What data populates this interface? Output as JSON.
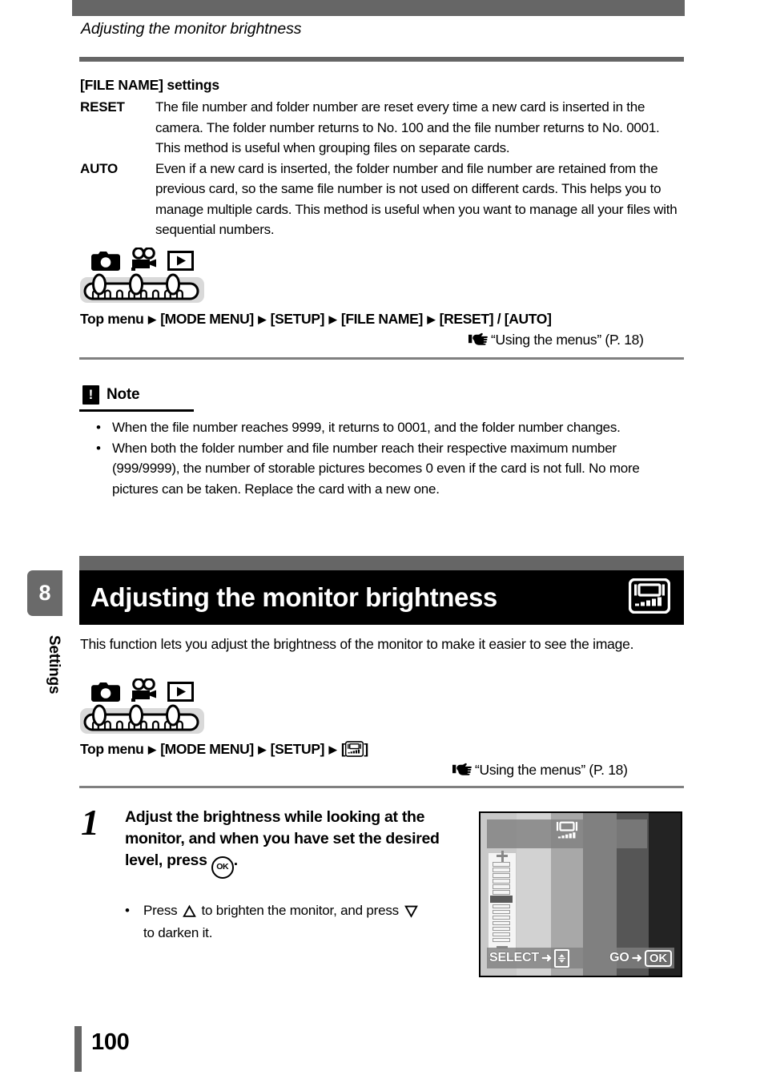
{
  "page": {
    "running_head": "Adjusting the monitor brightness",
    "number": "100"
  },
  "chapter_tab": {
    "number": "8",
    "label": "Settings"
  },
  "file_name_section": {
    "title": "[FILE NAME] settings",
    "definitions": [
      {
        "term": "RESET",
        "body": "The file number and folder number are reset every time a new card is inserted in the camera. The folder number returns to No. 100 and the file number returns to No. 0001. This method is useful when grouping files on separate cards."
      },
      {
        "term": "AUTO",
        "body": "Even if a new card is inserted, the folder number and file number are retained from the previous card, so the same file number is not used on different cards. This helps you to manage multiple cards. This method is useful when you want to manage all your files with sequential numbers."
      }
    ],
    "mode_icons": [
      "camera-icon",
      "movie-icon",
      "playback-icon",
      "mode-dial-icon"
    ],
    "path": {
      "start": "Top menu",
      "arrow": "▶",
      "steps": [
        "[MODE MENU]",
        "[SETUP]",
        "[FILE NAME]",
        "[RESET] / [AUTO]"
      ]
    },
    "reference": {
      "hand": "hand-pointer-icon",
      "text": "“Using the menus” (P. 18)"
    }
  },
  "note": {
    "badge": "!",
    "label": "Note",
    "bullet": "•",
    "items": [
      "When the file number reaches 9999, it returns to 0001, and the folder number changes.",
      "When both the folder number and file number reach their respective maximum number (999/9999), the number of storable pictures becomes 0 even if the card is not full. No more pictures can be taken. Replace the card with a new one."
    ]
  },
  "brightness_section": {
    "banner_title": "Adjusting the monitor brightness",
    "banner_icon": "monitor-brightness-icon",
    "intro": "This function lets you adjust the brightness of the monitor to make it easier to see the image.",
    "mode_icons": [
      "camera-icon",
      "movie-icon",
      "playback-icon",
      "mode-dial-icon"
    ],
    "path": {
      "start": "Top menu",
      "arrow": "▶",
      "steps": [
        "[MODE MENU]",
        "[SETUP]"
      ],
      "final_open": "[",
      "final_icon": "monitor-brightness-icon",
      "final_close": "]"
    },
    "reference": {
      "hand": "hand-pointer-icon",
      "text": "“Using the menus” (P. 18)"
    }
  },
  "step": {
    "number": "1",
    "instruction_a": "Adjust the brightness while looking at the monitor, and when you have set the desired level, press ",
    "ok_glyph": "OK",
    "instruction_b": ".",
    "bullet": "•",
    "sub_a": "Press ",
    "up_glyph": "up-triangle-icon",
    "sub_b": " to brighten the monitor, and press ",
    "down_glyph": "down-triangle-icon",
    "sub_c": " to darken it."
  },
  "camera_screen": {
    "top_icon": "monitor-brightness-icon",
    "slider": {
      "plus": "+",
      "minus": "−",
      "segments": 14,
      "active_index": 6
    },
    "osd_left_label": "SELECT",
    "osd_left_arrow": "➜",
    "osd_left_icon": "up-down-pad-icon",
    "osd_right_label": "GO",
    "osd_right_arrow": "➜",
    "osd_right_button": "OK",
    "gradient_bands": [
      "#c9c9c9",
      "#d2d2d2",
      "#a8a8a8",
      "#808080",
      "#565656",
      "#232323"
    ]
  },
  "colors": {
    "band_gray": "#666666",
    "banner_black": "#000000",
    "tab_gray": "#6a6a6a"
  }
}
